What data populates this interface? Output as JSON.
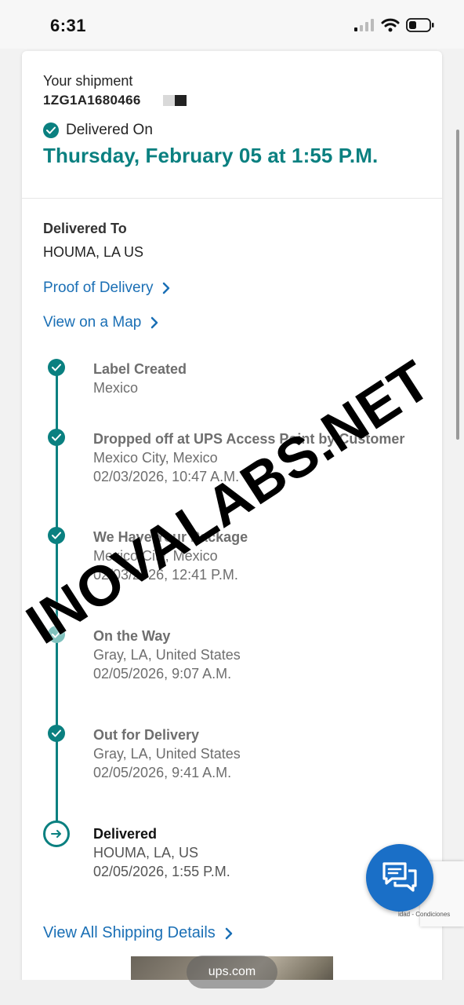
{
  "status_bar": {
    "time": "6:31"
  },
  "shipment": {
    "label": "Your shipment",
    "tracking_number": "1ZG1A1680466",
    "delivered_on_label": "Delivered On",
    "delivery_date": "Thursday, February 05 at 1:55 P.M."
  },
  "delivered_to": {
    "label": "Delivered To",
    "value": "HOUMA, LA US"
  },
  "links": {
    "proof_of_delivery": "Proof of Delivery",
    "view_on_map": "View on a Map",
    "view_all_details": "View All Shipping Details"
  },
  "timeline": [
    {
      "title": "Label Created",
      "location": "Mexico",
      "datetime": ""
    },
    {
      "title": "Dropped off at UPS Access Point by Customer",
      "location": "Mexico City, Mexico",
      "datetime": "02/03/2026, 10:47 A.M."
    },
    {
      "title": "We Have Your Package",
      "location": "Mexico City, Mexico",
      "datetime": "02/03/2026, 12:41 P.M."
    },
    {
      "title": "On the Way",
      "location": "Gray, LA, United States",
      "datetime": "02/05/2026, 9:07 A.M."
    },
    {
      "title": "Out for Delivery",
      "location": "Gray, LA, United States",
      "datetime": "02/05/2026, 9:41 A.M."
    },
    {
      "title": "Delivered",
      "location": "HOUMA, LA, US",
      "datetime": "02/05/2026, 1:55 P.M."
    }
  ],
  "browser": {
    "url": "ups.com"
  },
  "recaptcha_terms": "idad - Condiciones",
  "watermark": "INOVALABS.NET",
  "colors": {
    "accent": "#0a8080",
    "link": "#1a6fb5",
    "chat": "#1a6fc7"
  },
  "icons": {
    "check": "check-circle-icon",
    "chevron": "chevron-right-icon",
    "current": "arrow-circle-icon",
    "chat": "chat-bubbles-icon"
  }
}
